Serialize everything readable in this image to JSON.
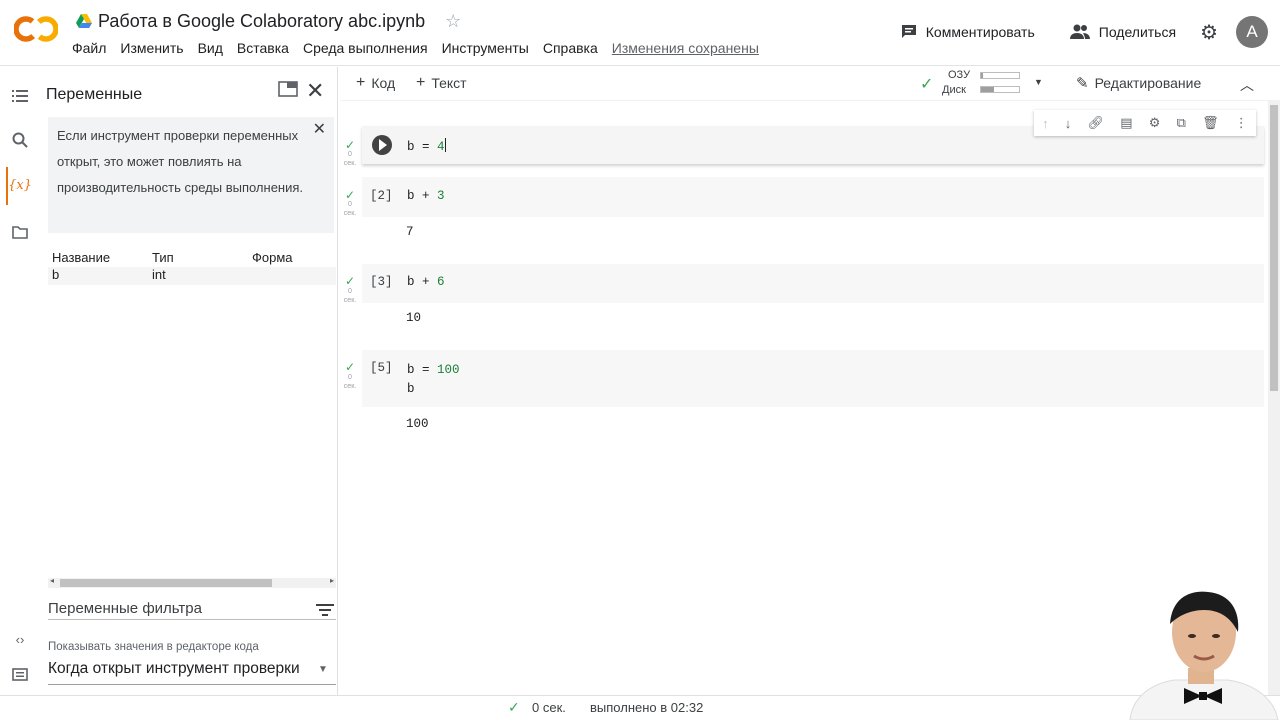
{
  "header": {
    "logo_text": "CO",
    "doc_title": "Работа в Google Colaboratory abc.ipynb",
    "menu": [
      "Файл",
      "Изменить",
      "Вид",
      "Вставка",
      "Среда выполнения",
      "Инструменты",
      "Справка"
    ],
    "saved_status": "Изменения сохранены",
    "comment_label": "Комментировать",
    "share_label": "Поделиться",
    "avatar_letter": "A"
  },
  "panel": {
    "title": "Переменные",
    "info_text": "Если инструмент проверки переменных открыт, это может повлиять на производительность среды выполнения.",
    "columns": [
      "Название",
      "Тип",
      "Форма"
    ],
    "variables": [
      {
        "name": "b",
        "type": "int",
        "shape": ""
      }
    ],
    "filter_label": "Переменные фильтра",
    "show_values_label": "Показывать значения в редакторе кода",
    "show_values_value": "Когда открыт инструмент проверки"
  },
  "toolbar": {
    "add_code": "Код",
    "add_text": "Текст",
    "ram_label": "ОЗУ",
    "disk_label": "Диск",
    "ram_usage": 0.05,
    "disk_usage": 0.35,
    "editing_label": "Редактирование"
  },
  "cells": [
    {
      "exec": "",
      "var": "b",
      "op": " = ",
      "num": "4",
      "extra": "",
      "output": "",
      "time": "0",
      "unit": "сек."
    },
    {
      "exec": "[2]",
      "var": "b",
      "op": " + ",
      "num": "3",
      "extra": "",
      "output": "7",
      "time": "0",
      "unit": "сек."
    },
    {
      "exec": "[3]",
      "var": "b",
      "op": " + ",
      "num": "6",
      "extra": "",
      "output": "10",
      "time": "0",
      "unit": "сек."
    },
    {
      "exec": "[5]",
      "var": "b",
      "op": " = ",
      "num": "100",
      "extra": "b",
      "output": "100",
      "time": "0",
      "unit": "сек."
    }
  ],
  "status": {
    "duration": "0 сек.",
    "completed": "выполнено в 02:32"
  },
  "colors": {
    "logo_orange": "#F9AB00",
    "logo_dark_orange": "#E8710A",
    "check_green": "#34A853",
    "number_green": "#1A7F37"
  }
}
